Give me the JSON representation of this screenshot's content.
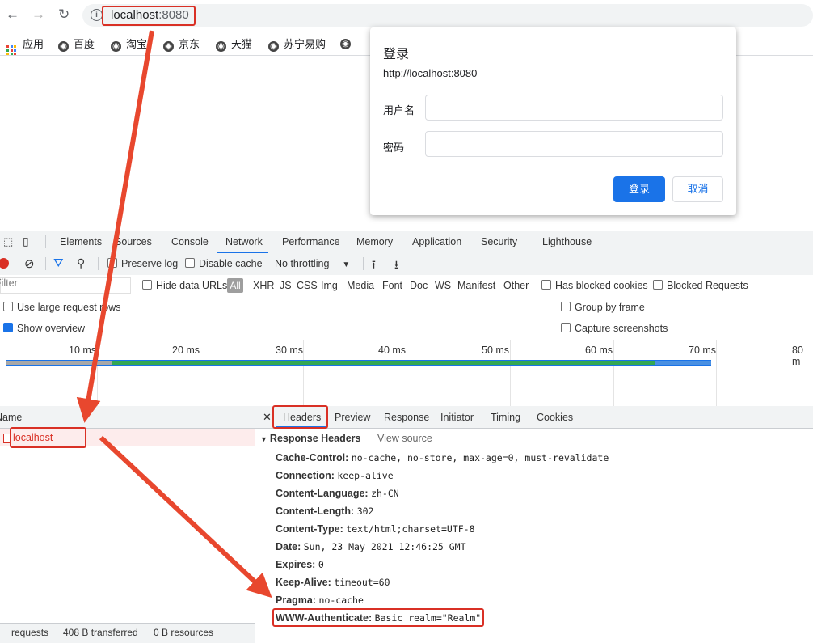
{
  "browser": {
    "url_host": "localhost",
    "url_port": ":8080",
    "bookmarks": [
      "应用",
      "百度",
      "淘宝",
      "京东",
      "天猫",
      "苏宁易购"
    ]
  },
  "login_dialog": {
    "title": "登录",
    "origin": "http://localhost:8080",
    "username_label": "用户名",
    "password_label": "密码",
    "username_value": "",
    "password_value": "",
    "ok_label": "登录",
    "cancel_label": "取消"
  },
  "devtools": {
    "tabs": [
      "Elements",
      "Sources",
      "Console",
      "Network",
      "Performance",
      "Memory",
      "Application",
      "Security",
      "Lighthouse"
    ],
    "active_tab": "Network",
    "toolbar": {
      "preserve_log": "Preserve log",
      "disable_cache": "Disable cache",
      "throttling": "No throttling"
    },
    "filter": {
      "placeholder": "Filter",
      "hide_data_urls": "Hide data URLs",
      "types": [
        "All",
        "XHR",
        "JS",
        "CSS",
        "Img",
        "Media",
        "Font",
        "Doc",
        "WS",
        "Manifest",
        "Other"
      ],
      "has_blocked_cookies": "Has blocked cookies",
      "blocked_requests": "Blocked Requests"
    },
    "settings": {
      "large_rows": "Use large request rows",
      "show_overview": "Show overview",
      "group_by_frame": "Group by frame",
      "capture_screenshots": "Capture screenshots"
    },
    "timeline_ticks": [
      "10 ms",
      "20 ms",
      "30 ms",
      "40 ms",
      "50 ms",
      "60 ms",
      "70 ms",
      "80 m"
    ],
    "name_column": "Name",
    "requests": [
      "localhost"
    ],
    "status_bar": [
      "requests",
      "408 B transferred",
      "0 B resources"
    ],
    "detail_tabs": [
      "Headers",
      "Preview",
      "Response",
      "Initiator",
      "Timing",
      "Cookies"
    ],
    "response_headers_title": "Response Headers",
    "view_source": "View source",
    "response_headers": [
      {
        "name": "Cache-Control:",
        "value": "no-cache, no-store, max-age=0, must-revalidate"
      },
      {
        "name": "Connection:",
        "value": "keep-alive"
      },
      {
        "name": "Content-Language:",
        "value": "zh-CN"
      },
      {
        "name": "Content-Length:",
        "value": "302"
      },
      {
        "name": "Content-Type:",
        "value": "text/html;charset=UTF-8"
      },
      {
        "name": "Date:",
        "value": "Sun, 23 May 2021 12:46:25 GMT"
      },
      {
        "name": "Expires:",
        "value": "0"
      },
      {
        "name": "Keep-Alive:",
        "value": "timeout=60"
      },
      {
        "name": "Pragma:",
        "value": "no-cache"
      },
      {
        "name": "WWW-Authenticate:",
        "value": "Basic realm=\"Realm\""
      }
    ]
  }
}
